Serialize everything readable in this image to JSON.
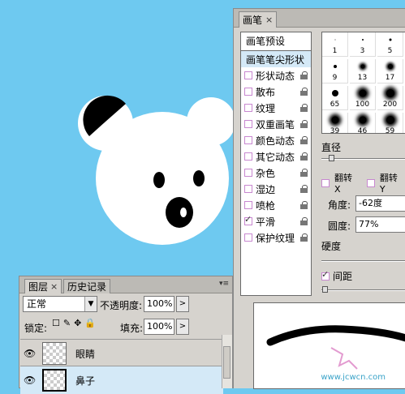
{
  "brush_panel": {
    "tab_label": "画笔",
    "close_glyph": "×",
    "presets_label": "画笔预设",
    "tip_shape_label": "画笔笔尖形状",
    "options": [
      {
        "label": "形状动态",
        "checked": false
      },
      {
        "label": "散布",
        "checked": false
      },
      {
        "label": "纹理",
        "checked": false
      },
      {
        "label": "双重画笔",
        "checked": false
      },
      {
        "label": "颜色动态",
        "checked": false
      },
      {
        "label": "其它动态",
        "checked": false
      },
      {
        "label": "杂色",
        "checked": false
      },
      {
        "label": "湿边",
        "checked": false
      },
      {
        "label": "喷枪",
        "checked": false
      },
      {
        "label": "平滑",
        "checked": true
      },
      {
        "label": "保护纹理",
        "checked": false
      }
    ],
    "tips": [
      "1",
      "3",
      "5",
      "9",
      "13",
      "17",
      "65",
      "100",
      "200",
      "39",
      "46",
      "59"
    ],
    "diameter_label": "直径",
    "flip_x_label": "翻转 X",
    "flip_y_label": "翻转 Y",
    "angle_label": "角度:",
    "angle_value": "-62度",
    "roundness_label": "圆度:",
    "roundness_value": "77%",
    "hardness_label": "硬度",
    "spacing_label": "间距",
    "spacing_checked": true,
    "watermark": "www.jcwcn.com"
  },
  "layers_panel": {
    "tabs": [
      "图层",
      "历史记录"
    ],
    "close_glyph": "×",
    "menu_glyph": "▾≡",
    "blend_mode": "正常",
    "opacity_label": "不透明度:",
    "opacity_value": "100%",
    "lock_label": "锁定:",
    "fill_label": "填充:",
    "fill_value": "100%",
    "layers": [
      {
        "name": "眼睛",
        "selected": false
      },
      {
        "name": "鼻子",
        "selected": true
      }
    ]
  },
  "colors": {
    "canvas_bg": "#6ec9f0",
    "bear_fill": "#ffffff",
    "bear_features": "#000000",
    "selection": "#d4e9f7"
  }
}
